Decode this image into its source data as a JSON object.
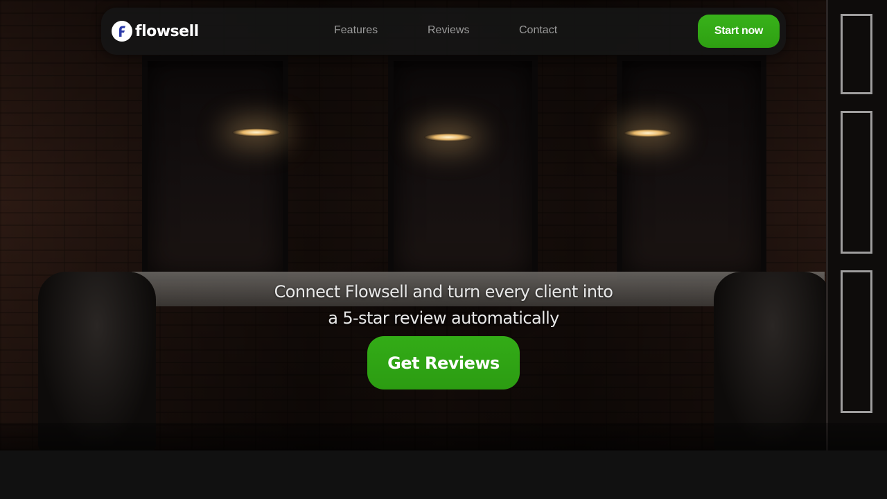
{
  "nav": {
    "brand": "flowsell",
    "logo_icon": "flowsell-f-logo-icon",
    "links": [
      {
        "label": "Features"
      },
      {
        "label": "Reviews"
      },
      {
        "label": "Contact"
      }
    ],
    "cta_label": "Start now"
  },
  "hero": {
    "headline_line1": "Connect Flowsell and turn every client into",
    "headline_line2": "a 5-star review automatically",
    "cta_label": "Get Reviews",
    "background_description": ""
  },
  "colors": {
    "accent": "#2e9f12",
    "nav_bg": "#161616",
    "page_bg": "#111111",
    "link": "#9a9a9a"
  }
}
